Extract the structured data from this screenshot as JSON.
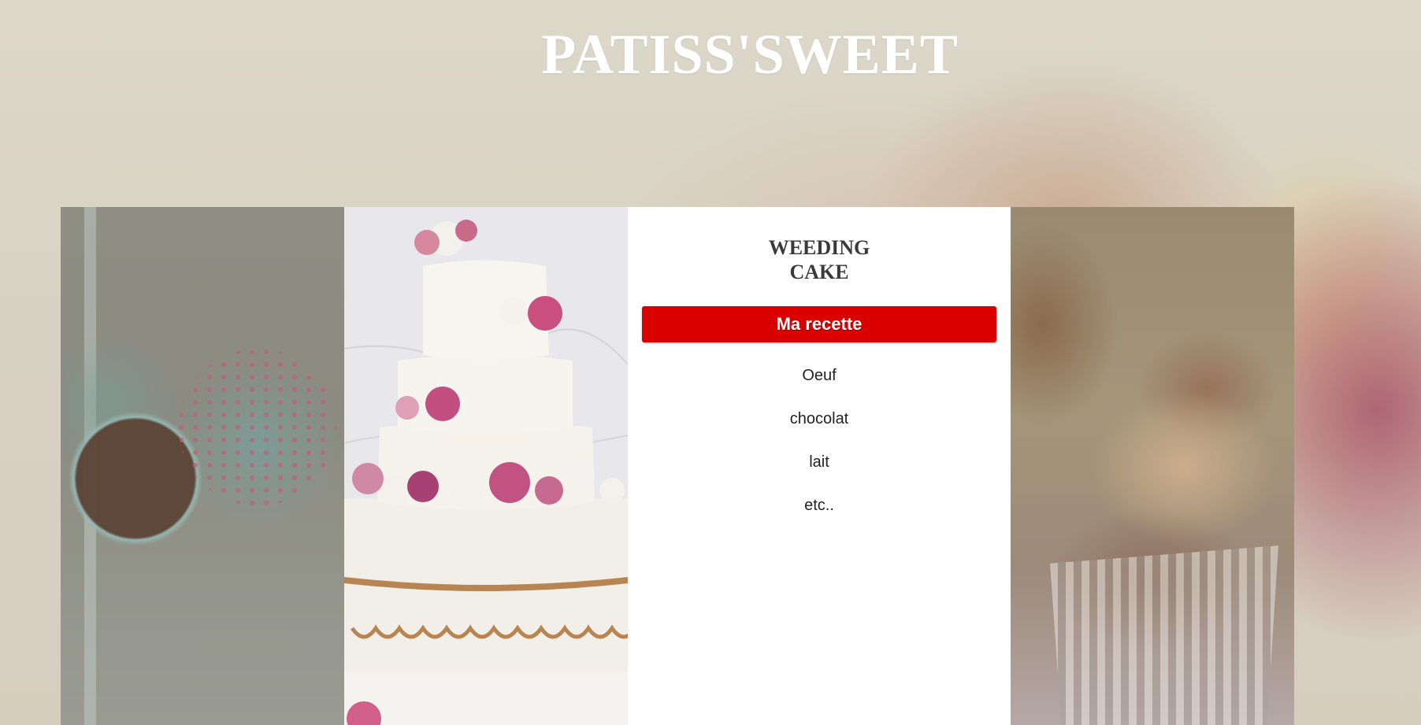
{
  "header": {
    "title": "PATISS'SWEET"
  },
  "recipe_card": {
    "title": "WEEDING CAKE",
    "button_label": "Ma recette",
    "ingredients": [
      "Oeuf",
      "chocolat",
      "lait",
      "etc.."
    ]
  },
  "colors": {
    "button_bg": "#d90000",
    "title_color": "#ffffff",
    "card_bg": "#ffffff"
  },
  "images": {
    "left_panel": "cake-pops-photo",
    "center_panel": "wedding-cake-photo",
    "right_panel": "cupcake-photo",
    "background": "macarons-photo"
  }
}
